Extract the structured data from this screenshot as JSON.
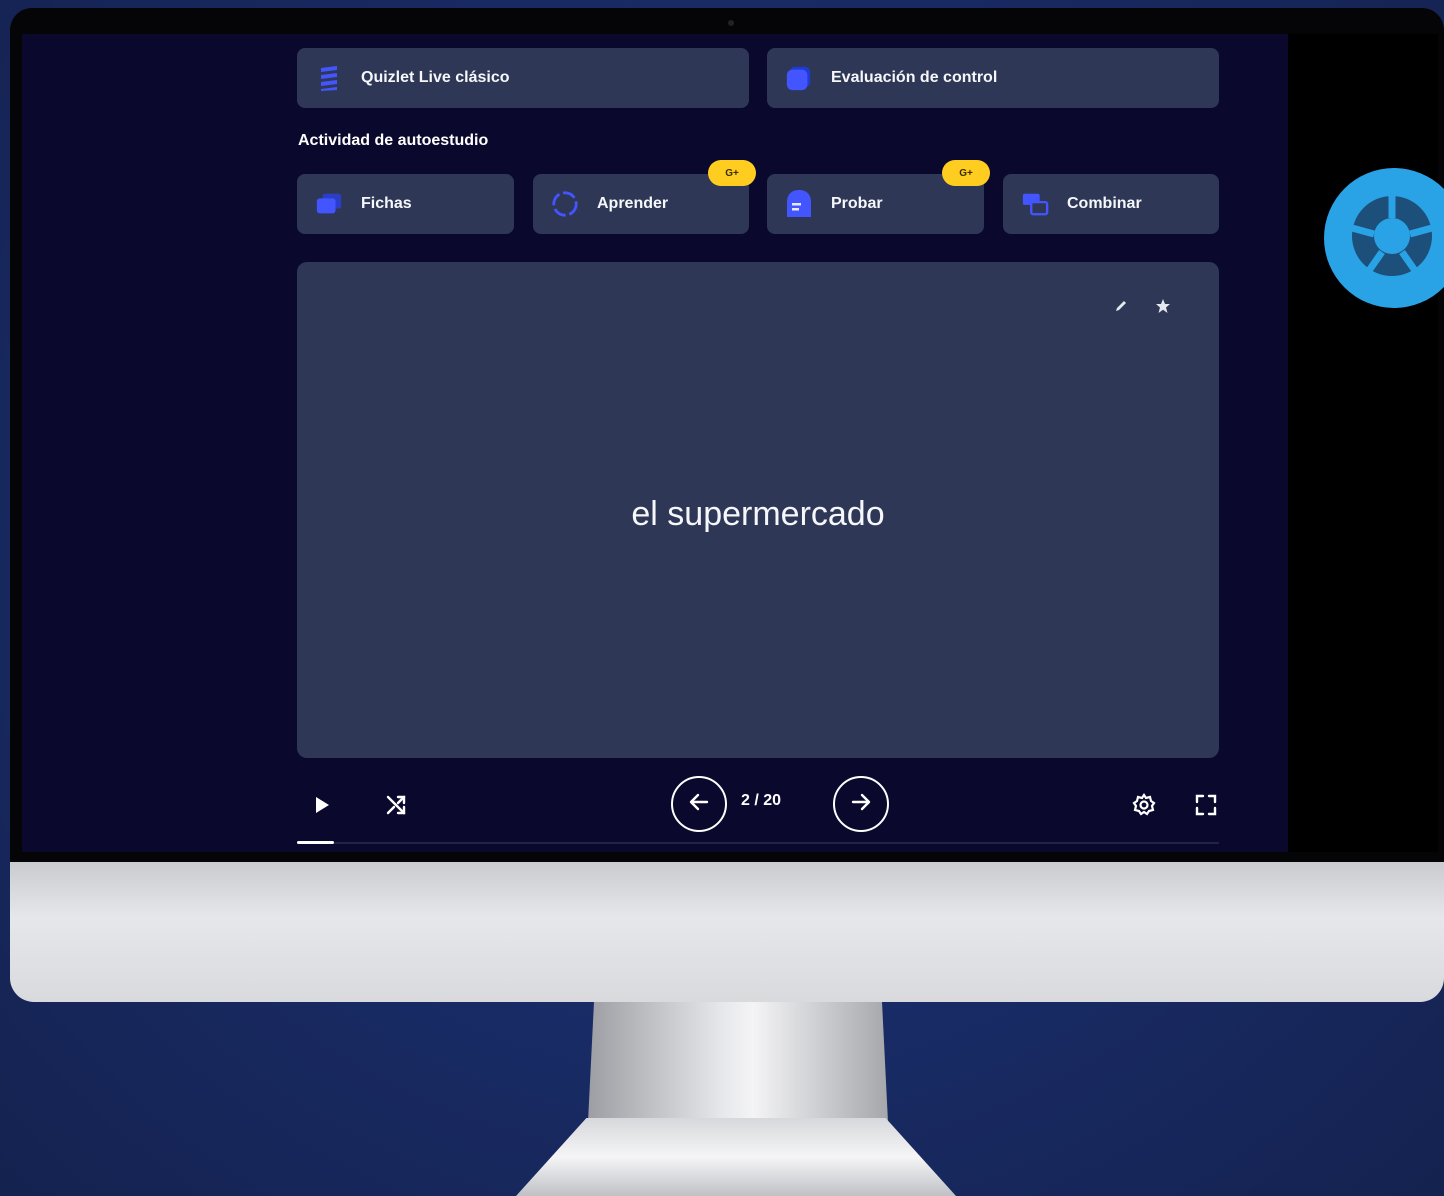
{
  "top_activities": [
    {
      "label": "Quizlet Live clásico",
      "icon": "quizlet-live-icon"
    },
    {
      "label": "Evaluación de control",
      "icon": "checkpoint-icon"
    }
  ],
  "self_study": {
    "section_title": "Actividad de autoestudio",
    "items": [
      {
        "label": "Fichas",
        "icon": "flashcards-icon",
        "badge": ""
      },
      {
        "label": "Aprender",
        "icon": "learn-icon",
        "badge": "G+"
      },
      {
        "label": "Probar",
        "icon": "test-icon",
        "badge": "G+"
      },
      {
        "label": "Combinar",
        "icon": "match-icon",
        "badge": ""
      }
    ]
  },
  "flashcard": {
    "term": "el supermercado",
    "tools": [
      "edit-icon",
      "star-icon"
    ]
  },
  "controls": {
    "counter": "2 / 20",
    "current": 2,
    "total": 20,
    "icons": [
      "play-icon",
      "shuffle-icon",
      "arrow-left-icon",
      "arrow-right-icon",
      "settings-icon",
      "fullscreen-icon"
    ]
  },
  "colors": {
    "screen_bg": "#0a092d",
    "card_bg": "#2e3856",
    "badge": "#ffcd1f",
    "accent_blue": "#4255ff",
    "fab": "#29a3e6"
  }
}
